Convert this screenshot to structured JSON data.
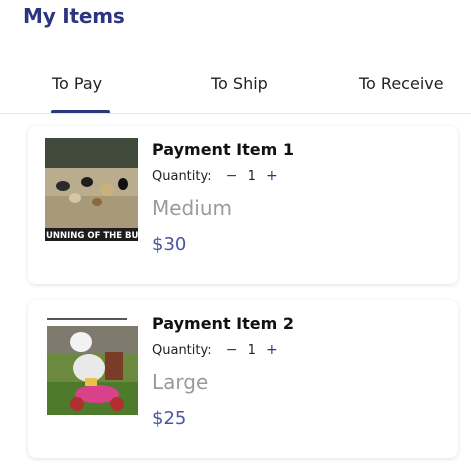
{
  "page": {
    "title": "My Items"
  },
  "tabs": [
    {
      "label": "To Pay",
      "active": true
    },
    {
      "label": "To Ship",
      "active": false
    },
    {
      "label": "To Receive",
      "active": false
    }
  ],
  "items": [
    {
      "name": "Payment Item 1",
      "quantity_label": "Quantity:",
      "quantity": "1",
      "size": "Medium",
      "price": "$30",
      "image_caption": "UNNING OF THE BUL"
    },
    {
      "name": "Payment Item 2",
      "quantity_label": "Quantity:",
      "quantity": "1",
      "size": "Large",
      "price": "$25"
    }
  ],
  "colors": {
    "brand": "#2e3580",
    "price": "#4a55a2",
    "muted": "#9a9a9a"
  }
}
